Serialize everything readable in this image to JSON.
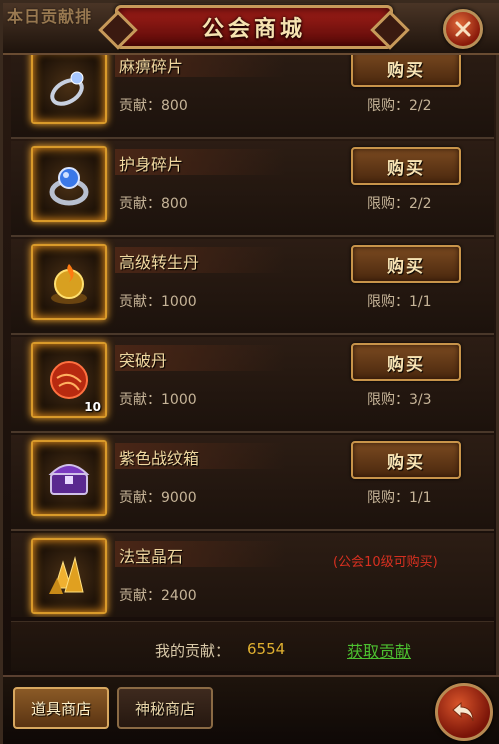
{
  "header": {
    "left_text": "本日贡献排",
    "title": "公会商城",
    "close_icon": "close-icon"
  },
  "items": [
    {
      "name": "麻痹碎片",
      "cost": "贡献：800",
      "buy_label": "购买",
      "limit": "限购：2/2",
      "count": "",
      "requirement": "",
      "icon": "ring-icon"
    },
    {
      "name": "护身碎片",
      "cost": "贡献：800",
      "buy_label": "购买",
      "limit": "限购：2/2",
      "count": "",
      "requirement": "",
      "icon": "gem-ring-icon"
    },
    {
      "name": "高级转生丹",
      "cost": "贡献：1000",
      "buy_label": "购买",
      "limit": "限购：1/1",
      "count": "",
      "requirement": "",
      "icon": "golden-pill-icon"
    },
    {
      "name": "突破丹",
      "cost": "贡献：1000",
      "buy_label": "购买",
      "limit": "限购：3/3",
      "count": "10",
      "requirement": "",
      "icon": "red-orb-icon"
    },
    {
      "name": "紫色战纹箱",
      "cost": "贡献：9000",
      "buy_label": "购买",
      "limit": "限购：1/1",
      "count": "",
      "requirement": "",
      "icon": "purple-chest-icon"
    },
    {
      "name": "法宝晶石",
      "cost": "贡献：2400",
      "buy_label": "",
      "limit": "",
      "count": "",
      "requirement": "(公会10级可购买)",
      "icon": "crystal-icon"
    }
  ],
  "footer": {
    "my_contrib_label": "我的贡献：",
    "my_contrib_value": "6554",
    "get_contrib_link": "获取贡献"
  },
  "tabs": [
    {
      "label": "道具商店",
      "active": true
    },
    {
      "label": "神秘商店",
      "active": false
    }
  ],
  "back_icon": "back-arrow-icon",
  "colors": {
    "title_red": "#a01e18",
    "gold_border": "#d99a2a",
    "contrib_value": "#e0b030",
    "link_green": "#4cc030",
    "requirement_red": "#d83020"
  }
}
